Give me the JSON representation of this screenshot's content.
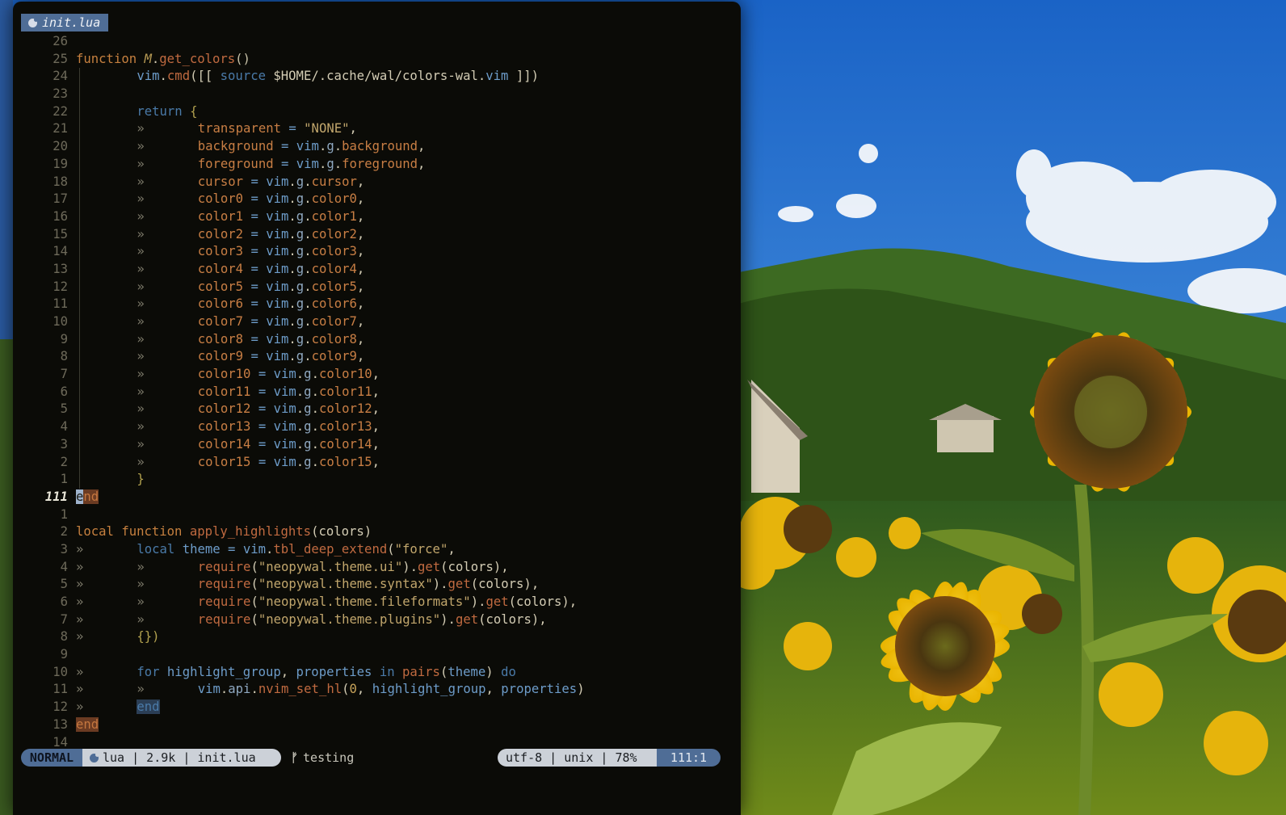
{
  "tab": {
    "label": "init.lua"
  },
  "colors": {
    "accent": "#4f6d96",
    "status_light": "#ccd1d8",
    "background": "#0b0b07"
  },
  "code": {
    "lines": [
      {
        "n": "26",
        "t": ""
      },
      {
        "n": "25",
        "t": "function M.get_colors()"
      },
      {
        "n": "24",
        "t": "vim.cmd([[ source $HOME/.cache/wal/colors-wal.vim ]])"
      },
      {
        "n": "23",
        "t": ""
      },
      {
        "n": "22",
        "t": "return {"
      },
      {
        "n": "21",
        "t": "transparent = \"NONE\","
      },
      {
        "n": "20",
        "t": "background = vim.g.background,"
      },
      {
        "n": "19",
        "t": "foreground = vim.g.foreground,"
      },
      {
        "n": "18",
        "t": "cursor = vim.g.cursor,"
      },
      {
        "n": "17",
        "t": "color0 = vim.g.color0,"
      },
      {
        "n": "16",
        "t": "color1 = vim.g.color1,"
      },
      {
        "n": "15",
        "t": "color2 = vim.g.color2,"
      },
      {
        "n": "14",
        "t": "color3 = vim.g.color3,"
      },
      {
        "n": "13",
        "t": "color4 = vim.g.color4,"
      },
      {
        "n": "12",
        "t": "color5 = vim.g.color5,"
      },
      {
        "n": "11",
        "t": "color6 = vim.g.color6,"
      },
      {
        "n": "10",
        "t": "color7 = vim.g.color7,"
      },
      {
        "n": "9",
        "t": "color8 = vim.g.color8,"
      },
      {
        "n": "8",
        "t": "color9 = vim.g.color9,"
      },
      {
        "n": "7",
        "t": "color10 = vim.g.color10,"
      },
      {
        "n": "6",
        "t": "color11 = vim.g.color11,"
      },
      {
        "n": "5",
        "t": "color12 = vim.g.color12,"
      },
      {
        "n": "4",
        "t": "color13 = vim.g.color13,"
      },
      {
        "n": "3",
        "t": "color14 = vim.g.color14,"
      },
      {
        "n": "2",
        "t": "color15 = vim.g.color15,"
      },
      {
        "n": "1",
        "t": "}"
      },
      {
        "n": "111",
        "t": "end"
      },
      {
        "n": "1",
        "t": ""
      },
      {
        "n": "2",
        "t": "local function apply_highlights(colors)"
      },
      {
        "n": "3",
        "t": "local theme = vim.tbl_deep_extend(\"force\","
      },
      {
        "n": "4",
        "t": "require(\"neopywal.theme.ui\").get(colors),"
      },
      {
        "n": "5",
        "t": "require(\"neopywal.theme.syntax\").get(colors),"
      },
      {
        "n": "6",
        "t": "require(\"neopywal.theme.fileformats\").get(colors),"
      },
      {
        "n": "7",
        "t": "require(\"neopywal.theme.plugins\").get(colors),"
      },
      {
        "n": "8",
        "t": "{})"
      },
      {
        "n": "9",
        "t": ""
      },
      {
        "n": "10",
        "t": "for highlight_group, properties in pairs(theme) do"
      },
      {
        "n": "11",
        "t": "vim.api.nvim_set_hl(0, highlight_group, properties)"
      },
      {
        "n": "12",
        "t": "end"
      },
      {
        "n": "13",
        "t": "end"
      },
      {
        "n": "14",
        "t": ""
      }
    ]
  },
  "status": {
    "mode": "NORMAL",
    "file_info": "lua | 2.9k | init.lua",
    "branch": "testing",
    "encoding": "utf-8 | unix | 78%",
    "position": "111:1"
  }
}
